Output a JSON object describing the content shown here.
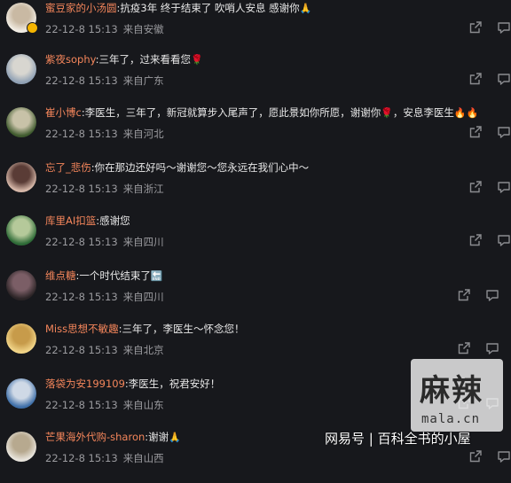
{
  "comments": [
    {
      "user": "蜜豆家的小汤圆",
      "text": ":抗疫3年  终于结束了  吹哨人安息  感谢你",
      "emoji": "🙏",
      "date": "22-12-8 15:13",
      "location": "来自安徽",
      "avatar_colors": [
        "#f2ede4",
        "#c9b9a3"
      ]
    },
    {
      "user": "紫夜sophy",
      "text": ":三年了，过来看看您",
      "emoji": "🌹",
      "date": "22-12-8 15:13",
      "location": "来自广东",
      "avatar_colors": [
        "#8fa0b4",
        "#d8d6d0"
      ]
    },
    {
      "user": "崔小博c",
      "text": ":李医生，三年了，新冠就算步入尾声了，愿此景如你所愿，谢谢你",
      "emoji": "🌹",
      "text2": "，安息李医生",
      "emoji2": "🔥🔥",
      "date": "22-12-8 15:13",
      "location": "来自河北",
      "avatar_colors": [
        "#3f5a2e",
        "#c8c2a8"
      ]
    },
    {
      "user": "忘了_悲伤",
      "text": ":你在那边还好吗～谢谢您～您永远在我们心中～",
      "emoji": "",
      "date": "22-12-8 15:13",
      "location": "来自浙江",
      "avatar_colors": [
        "#d7b8a9",
        "#5a3c36"
      ]
    },
    {
      "user": "库里AI扣篮",
      "text": ":感谢您",
      "emoji": "",
      "date": "22-12-8 15:13",
      "location": "来自四川",
      "avatar_colors": [
        "#2e6b37",
        "#b5c99a"
      ]
    },
    {
      "user": "维点糖",
      "text": ":一个时代结束了",
      "emoji": "🔚",
      "date": "22-12-8 15:13",
      "location": "来自四川",
      "avatar_colors": [
        "#2b2426",
        "#7b5e66"
      ]
    },
    {
      "user": "Miss思想不敏趣",
      "text": ":三年了，李医生～怀念您！",
      "emoji": "",
      "date": "22-12-8 15:13",
      "location": "来自北京",
      "avatar_colors": [
        "#f1d488",
        "#c79b4a"
      ]
    },
    {
      "user": "落袋为安199109",
      "text": ":李医生，祝君安好！",
      "emoji": "",
      "date": "22-12-8 15:13",
      "location": "来自山东",
      "avatar_colors": [
        "#3f6fa8",
        "#cfd9e6"
      ]
    },
    {
      "user": "芒果海外代购-sharon",
      "text": ":谢谢",
      "emoji": "🙏",
      "date": "22-12-8 15:13",
      "location": "来自山西",
      "avatar_colors": [
        "#e8e4dc",
        "#b7a98f"
      ]
    }
  ],
  "icons": {
    "share": "share-icon",
    "more": "more-icon"
  },
  "watermark": {
    "big": "麻辣",
    "small": "mala.cn",
    "credit": "网易号 | 百科全书的小屋"
  },
  "colors": {
    "background": "#17181c",
    "username": "#f5865b",
    "meta": "#9a9a9e"
  }
}
